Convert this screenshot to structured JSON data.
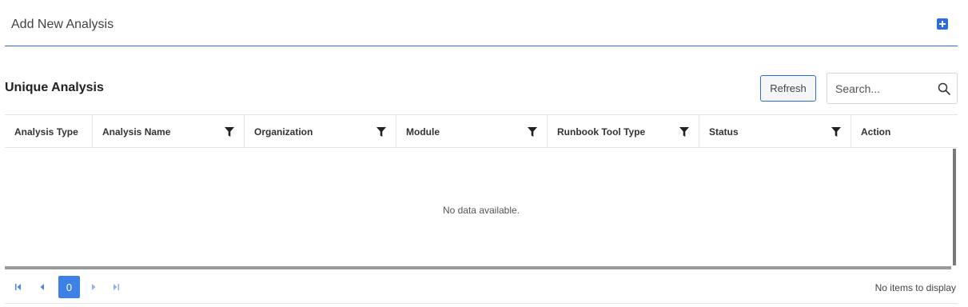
{
  "header": {
    "title": "Add New Analysis",
    "add_icon": "plus-square-icon"
  },
  "section": {
    "title": "Unique Analysis"
  },
  "toolbar": {
    "refresh_label": "Refresh"
  },
  "search": {
    "placeholder": "Search...",
    "value": ""
  },
  "grid": {
    "columns": [
      {
        "label": "Analysis Type",
        "filter": false
      },
      {
        "label": "Analysis Name",
        "filter": true
      },
      {
        "label": "Organization",
        "filter": true
      },
      {
        "label": "Module",
        "filter": true
      },
      {
        "label": "Runbook Tool Type",
        "filter": true
      },
      {
        "label": "Status",
        "filter": true
      },
      {
        "label": "Action",
        "filter": false
      }
    ],
    "empty_message": "No data available."
  },
  "pager": {
    "current_page": "0",
    "info": "No items to display"
  },
  "colors": {
    "accent": "#2d6cdf",
    "page_active": "#3d80e6"
  }
}
